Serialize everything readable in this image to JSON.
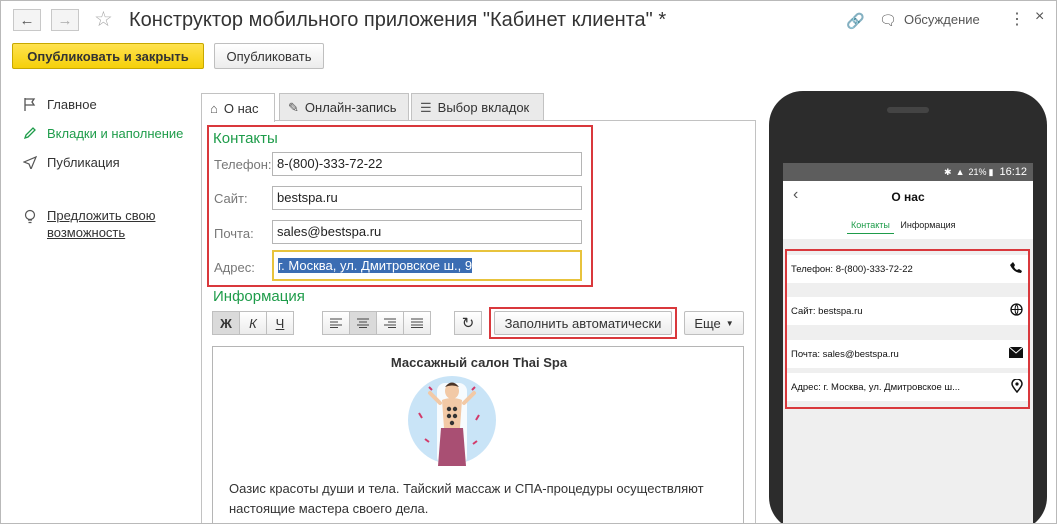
{
  "window": {
    "title": "Конструктор мобильного приложения \"Кабинет клиента\" *",
    "discussion": "Обсуждение"
  },
  "toolbar": {
    "publish_close": "Опубликовать и закрыть",
    "publish": "Опубликовать"
  },
  "sidebar": {
    "items": [
      {
        "label": "Главное",
        "icon": "flag-icon"
      },
      {
        "label": "Вкладки и наполнение",
        "icon": "pencil-icon"
      },
      {
        "label": "Публикация",
        "icon": "send-icon"
      }
    ],
    "suggest": "Предложить свою возможность"
  },
  "tabs": [
    {
      "label": "О нас",
      "icon": "home-icon"
    },
    {
      "label": "Онлайн-запись",
      "icon": "edit-icon"
    },
    {
      "label": "Выбор вкладок",
      "icon": "list-icon"
    }
  ],
  "contacts": {
    "title": "Контакты",
    "phone_label": "Телефон:",
    "phone": "8-(800)-333-72-22",
    "site_label": "Сайт:",
    "site": "bestspa.ru",
    "mail_label": "Почта:",
    "mail": "sales@bestspa.ru",
    "address_label": "Адрес:",
    "address": "г. Москва, ул. Дмитровское ш., 9"
  },
  "info": {
    "title": "Информация",
    "bold": "Ж",
    "italic": "К",
    "underline": "Ч",
    "autofill": "Заполнить автоматически",
    "more": "Еще",
    "editor_title": "Массажный салон Thai Spa",
    "editor_text": "Оазис красоты души и тела. Тайский массаж и СПА-процедуры осуществляют настоящие мастера своего дела."
  },
  "phone": {
    "battery": "21%",
    "time": "16:12",
    "title": "О нас",
    "tabs": [
      "Контакты",
      "Информация"
    ],
    "rows": [
      {
        "text": "Телефон: 8-(800)-333-72-22",
        "icon": "phone-icon"
      },
      {
        "text": "Сайт: bestspa.ru",
        "icon": "globe-icon"
      },
      {
        "text": "Почта: sales@bestspa.ru",
        "icon": "mail-icon"
      },
      {
        "text": "Адрес: г. Москва, ул. Дмитровское ш...",
        "icon": "location-icon"
      }
    ]
  },
  "colors": {
    "accent_green": "#1e9c4a",
    "highlight_red": "#d9383c",
    "primary_yellow": "#f5d00a"
  }
}
